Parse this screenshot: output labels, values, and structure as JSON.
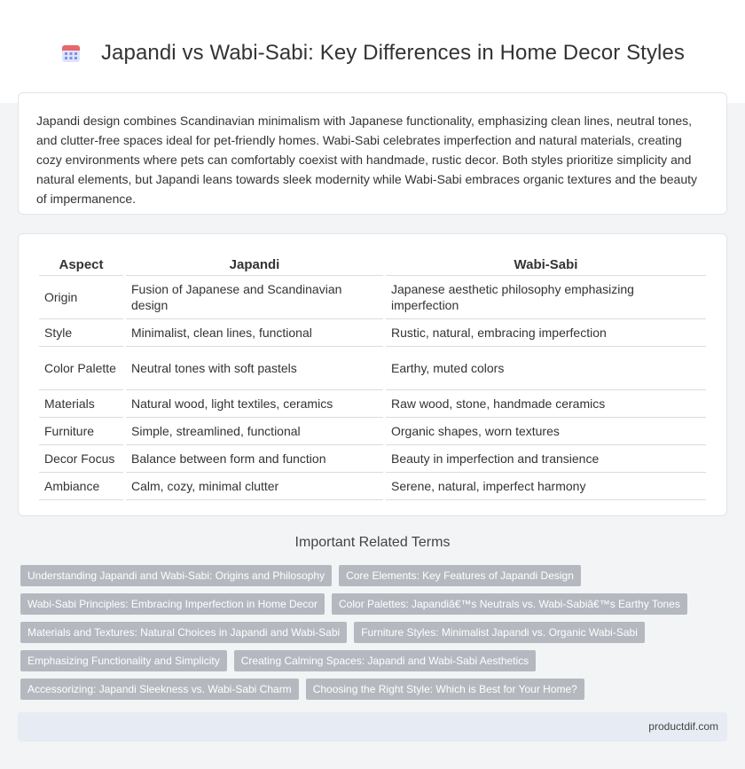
{
  "header": {
    "title": "Japandi vs Wabi-Sabi: Key Differences in Home Decor Styles",
    "icon": "calendar-icon"
  },
  "intro": {
    "text": "Japandi design combines Scandinavian minimalism with Japanese functionality, emphasizing clean lines, neutral tones, and clutter-free spaces ideal for pet-friendly homes. Wabi-Sabi celebrates imperfection and natural materials, creating cozy environments where pets can comfortably coexist with handmade, rustic decor. Both styles prioritize simplicity and natural elements, but Japandi leans towards sleek modernity while Wabi-Sabi embraces organic textures and the beauty of impermanence."
  },
  "table": {
    "headers": [
      "Aspect",
      "Japandi",
      "Wabi-Sabi"
    ],
    "rows": [
      [
        "Origin",
        "Fusion of Japanese and Scandinavian design",
        "Japanese aesthetic philosophy emphasizing imperfection"
      ],
      [
        "Style",
        "Minimalist, clean lines, functional",
        "Rustic, natural, embracing imperfection"
      ],
      [
        "Color Palette",
        "Neutral tones with soft pastels",
        "Earthy, muted colors"
      ],
      [
        "Materials",
        "Natural wood, light textiles, ceramics",
        "Raw wood, stone, handmade ceramics"
      ],
      [
        "Furniture",
        "Simple, streamlined, functional",
        "Organic shapes, worn textures"
      ],
      [
        "Decor Focus",
        "Balance between form and function",
        "Beauty in imperfection and transience"
      ],
      [
        "Ambiance",
        "Calm, cozy, minimal clutter",
        "Serene, natural, imperfect harmony"
      ]
    ]
  },
  "related": {
    "title": "Important Related Terms",
    "tags": [
      "Understanding Japandi and Wabi-Sabi: Origins and Philosophy",
      "Core Elements: Key Features of Japandi Design",
      "Wabi-Sabi Principles: Embracing Imperfection in Home Decor",
      "Color Palettes: Japandiâ€™s Neutrals vs. Wabi-Sabiâ€™s Earthy Tones",
      "Materials and Textures: Natural Choices in Japandi and Wabi-Sabi",
      "Furniture Styles: Minimalist Japandi vs. Organic Wabi-Sabi",
      "Emphasizing Functionality and Simplicity",
      "Creating Calming Spaces: Japandi and Wabi-Sabi Aesthetics",
      "Accessorizing: Japandi Sleekness vs. Wabi-Sabi Charm",
      "Choosing the Right Style: Which is Best for Your Home?"
    ]
  },
  "footer": {
    "site": "productdif.com"
  },
  "colors": {
    "tag_bg": "#b5b9bf",
    "footer_bg": "#e7ebf3",
    "icon_accent": "#7b8fe6"
  }
}
